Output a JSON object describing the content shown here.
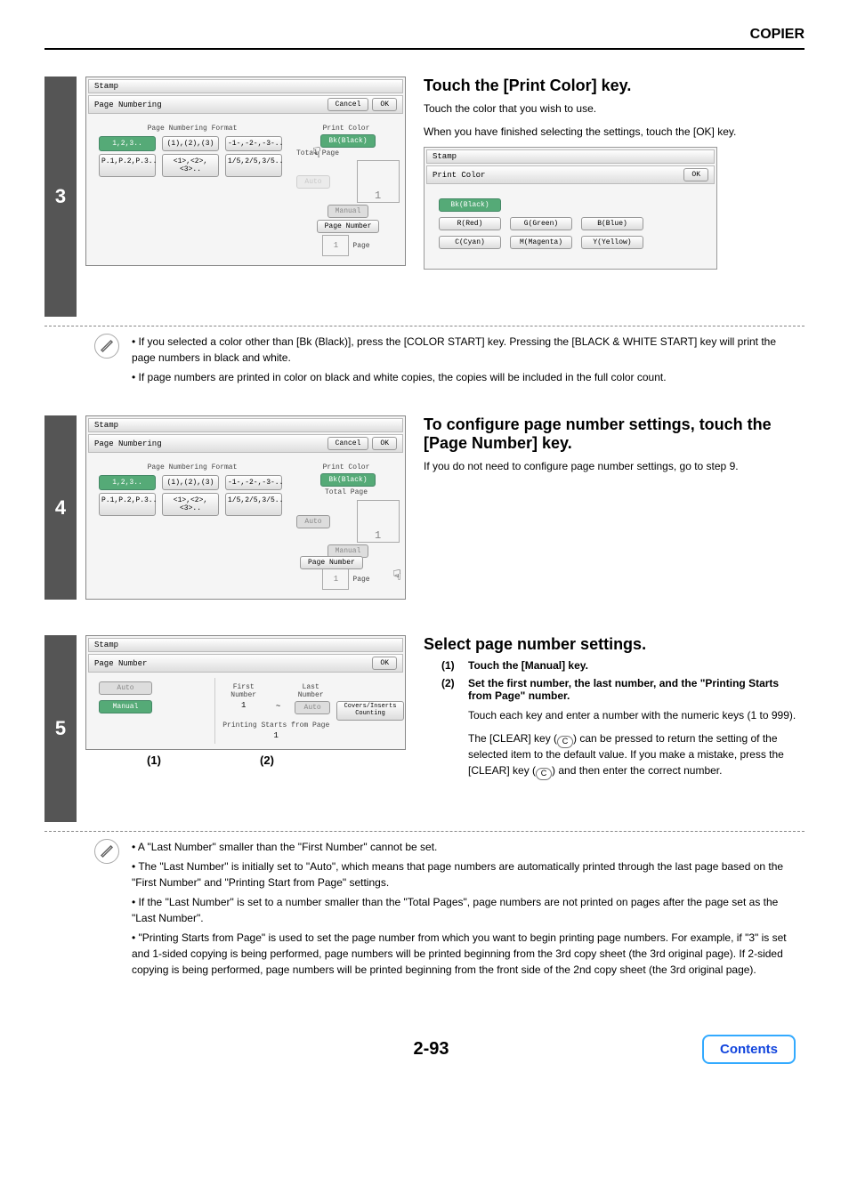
{
  "header": {
    "section": "COPIER"
  },
  "step3": {
    "num": "3",
    "title": "Touch the [Print Color] key.",
    "p1": "Touch the color that you wish to use.",
    "p2": "When you have finished selecting the settings, touch the [OK] key.",
    "left": {
      "stamp": "Stamp",
      "pn": "Page Numbering",
      "cancel": "Cancel",
      "ok": "OK",
      "format_label": "Page Numbering Format",
      "fmts": [
        "1,2,3..",
        "(1),(2),(3)",
        "-1-,-2-,-3-..",
        "P.1,P.2,P.3..",
        "<1>,<2>,<3>..",
        "1/5,2/5,3/5.."
      ],
      "print_color": "Print Color",
      "bk": "Bk(Black)",
      "total_page": "Total Page",
      "auto": "Auto",
      "manual": "Manual",
      "one": "1",
      "page": "Page",
      "page_number": "Page Number"
    },
    "right": {
      "stamp": "Stamp",
      "pc": "Print Color",
      "ok": "OK",
      "colors": [
        "Bk(Black)",
        "R(Red)",
        "G(Green)",
        "B(Blue)",
        "C(Cyan)",
        "M(Magenta)",
        "Y(Yellow)"
      ]
    },
    "notes": [
      "If you selected a color other than [Bk (Black)], press the [COLOR START] key. Pressing the [BLACK & WHITE START] key will print the page numbers in black and white.",
      "If page numbers are printed in color on black and white copies, the copies will be included in the full color count."
    ]
  },
  "step4": {
    "num": "4",
    "title": "To configure page number settings, touch the [Page Number] key.",
    "p1": "If you do not need to configure page number settings, go to step 9.",
    "left": {
      "stamp": "Stamp",
      "pn": "Page Numbering",
      "cancel": "Cancel",
      "ok": "OK",
      "format_label": "Page Numbering Format",
      "fmts": [
        "1,2,3..",
        "(1),(2),(3)",
        "-1-,-2-,-3-..",
        "P.1,P.2,P.3..",
        "<1>,<2>,<3>..",
        "1/5,2/5,3/5.."
      ],
      "print_color": "Print Color",
      "bk": "Bk(Black)",
      "total_page": "Total Page",
      "auto": "Auto",
      "manual": "Manual",
      "one": "1",
      "page": "Page",
      "page_number": "Page Number"
    }
  },
  "step5": {
    "num": "5",
    "title": "Select page number settings.",
    "l1_num": "(1)",
    "l1": "Touch the [Manual] key.",
    "l2_num": "(2)",
    "l2": "Set the first number, the last number, and the \"Printing Starts from Page\" number.",
    "l2a": "Touch each key and enter a number with the numeric keys (1 to 999).",
    "l2b_a": "The [CLEAR] key (",
    "l2b_b": ") can be pressed to return the setting of the selected item to the default value. If you make a mistake, press the [CLEAR] key (",
    "l2b_c": ") and then enter the correct number.",
    "clear_c": "C",
    "callout1": "(1)",
    "callout2": "(2)",
    "left": {
      "stamp": "Stamp",
      "pn": "Page Number",
      "ok": "OK",
      "auto": "Auto",
      "manual": "Manual",
      "first": "First Number",
      "last": "Last Number",
      "one": "1",
      "tilde": "~",
      "auto2": "Auto",
      "starts": "Printing Starts from Page",
      "covers": "Covers/Inserts Counting"
    },
    "notes": [
      "A \"Last Number\" smaller than the \"First Number\" cannot be set.",
      "The \"Last Number\" is initially set to \"Auto\", which means that page numbers are automatically printed through the last page based on the \"First Number\" and \"Printing Start from Page\" settings.",
      "If the \"Last Number\" is set to a number smaller than the \"Total Pages\", page numbers are not printed on pages after the page set as the \"Last Number\".",
      "\"Printing Starts from Page\" is used to set the page number from which you want to begin printing page numbers. For example, if \"3\" is set and 1-sided copying is being performed, page numbers will be printed beginning from the 3rd copy sheet (the 3rd original page). If 2-sided copying is being performed, page numbers will be printed beginning from the front side of the 2nd copy sheet (the 3rd original page)."
    ]
  },
  "footer": {
    "page": "2-93",
    "contents": "Contents"
  }
}
